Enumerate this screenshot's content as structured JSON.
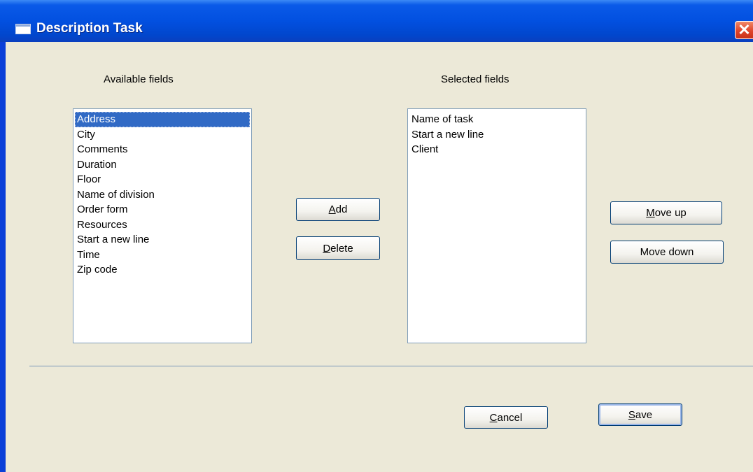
{
  "window": {
    "title": "Description Task",
    "close_glyph": "✕"
  },
  "available": {
    "label": "Available fields",
    "items": [
      "Address",
      "City",
      "Comments",
      "Duration",
      "Floor",
      "Name of division",
      "Order form",
      "Resources",
      "Start a new line",
      "Time",
      "Zip code"
    ],
    "selected_item": "Address"
  },
  "selected": {
    "label": "Selected fields",
    "items": [
      "Name of task",
      "Start a new line",
      "Client"
    ]
  },
  "buttons": {
    "add": {
      "mnemonic": "A",
      "rest": "dd"
    },
    "delete": {
      "mnemonic": "D",
      "rest": "elete"
    },
    "move_up": {
      "mnemonic": "M",
      "rest": "ove up"
    },
    "move_down": {
      "label": "Move down"
    },
    "cancel": {
      "mnemonic": "C",
      "rest": "ancel"
    },
    "save": {
      "mnemonic": "S",
      "rest": "ave"
    }
  },
  "colors": {
    "titlebar": "#0250e0",
    "dialog_background": "#ece9d8",
    "selection": "#316ac5",
    "close_button": "#e0442a"
  }
}
